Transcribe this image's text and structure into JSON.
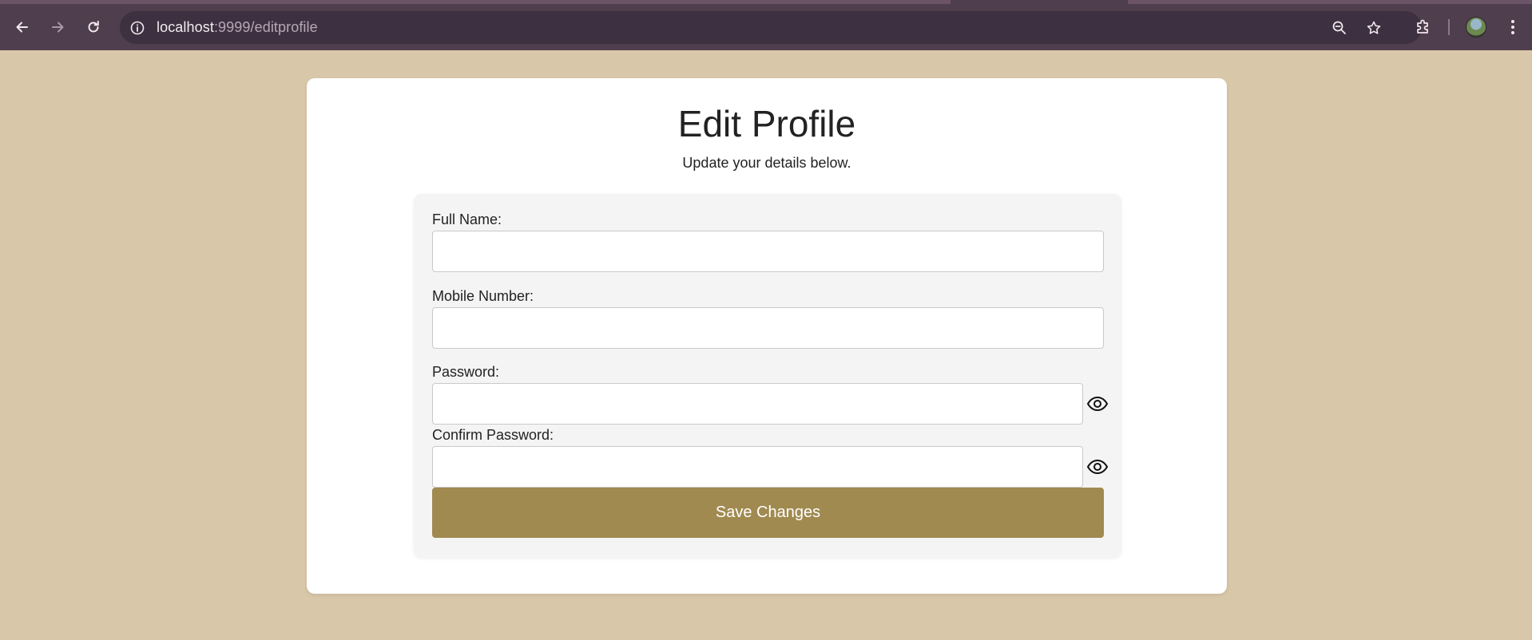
{
  "browser": {
    "url_host": "localhost",
    "url_path": ":9999/editprofile"
  },
  "page": {
    "title": "Edit Profile",
    "subtitle": "Update your details below."
  },
  "form": {
    "full_name_label": "Full Name:",
    "full_name_value": "",
    "mobile_label": "Mobile Number:",
    "mobile_value": "",
    "password_label": "Password:",
    "password_value": "",
    "confirm_password_label": "Confirm Password:",
    "confirm_password_value": "",
    "save_label": "Save Changes"
  },
  "colors": {
    "page_background": "#d9c7a9",
    "button_background": "#a08a50",
    "browser_chrome": "#4f3e4d"
  },
  "icons": {
    "back": "arrow-left-icon",
    "forward": "arrow-right-icon",
    "reload": "reload-icon",
    "site_info": "info-icon",
    "zoom": "zoom-out-icon",
    "bookmark": "star-icon",
    "extensions": "puzzle-icon",
    "menu": "kebab-menu-icon",
    "show_password": "eye-icon"
  }
}
